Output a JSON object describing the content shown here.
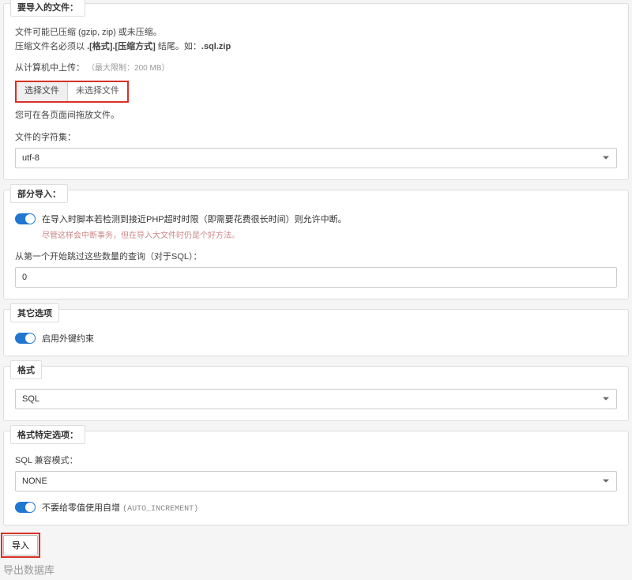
{
  "file_panel": {
    "legend": "要导入的文件：",
    "line1_a": "文件可能已压缩 (gzip, zip) 或未压缩。",
    "line1_b_pre": "压缩文件名必须以 ",
    "line1_b_bold": ".[格式].[压缩方式]",
    "line1_b_mid": " 结尾。如：",
    "line1_b_bold2": ".sql.zip",
    "upload_label": "从计算机中上传：",
    "upload_hint": "（最大限制：200 MB）",
    "choose_file": "选择文件",
    "no_file": "未选择文件",
    "drag_hint": "您可在各页面间拖放文件。",
    "charset_label": "文件的字符集：",
    "charset_value": "utf-8"
  },
  "partial_panel": {
    "legend": "部分导入：",
    "allow_interrupt": "在导入时脚本若检测到接近PHP超时时限（即需要花费很长时间）则允许中断。",
    "interrupt_hint": "尽管这样会中断事务，但在导入大文件时仍是个好方法。",
    "skip_label": "从第一个开始跳过这些数量的查询（对于SQL）：",
    "skip_value": "0"
  },
  "other_panel": {
    "legend": "其它选项",
    "fk_label": "启用外键约束"
  },
  "format_panel": {
    "legend": "格式",
    "value": "SQL"
  },
  "format_opts_panel": {
    "legend": "格式特定选项：",
    "compat_label": "SQL 兼容模式：",
    "compat_value": "NONE",
    "no_zero_label": "不要给零值使用自增 ",
    "no_zero_code": "(AUTO_INCREMENT)"
  },
  "submit_label": "导入",
  "footer": "导出数据库"
}
